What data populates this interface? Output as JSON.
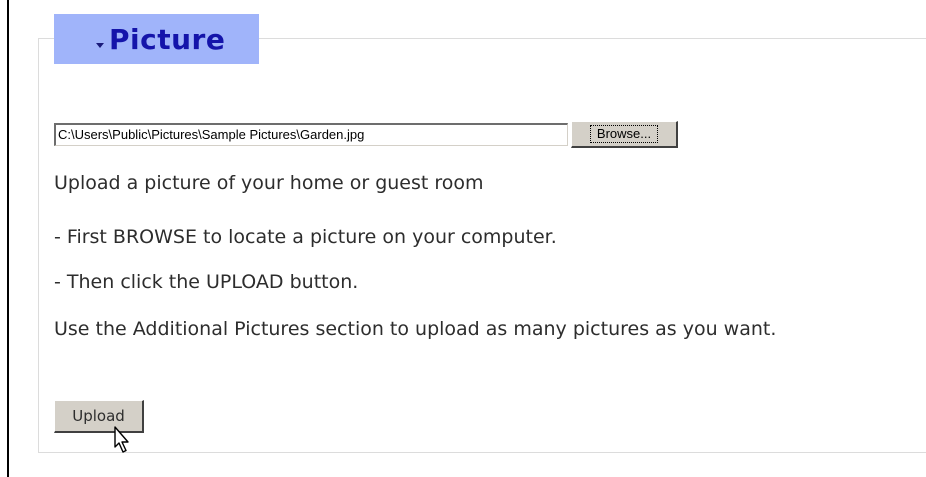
{
  "section": {
    "title": "Picture",
    "caret_icon": "caret-down-icon"
  },
  "file_input": {
    "value": "C:\\Users\\Public\\Pictures\\Sample Pictures\\Garden.jpg"
  },
  "buttons": {
    "browse_label": "Browse...",
    "upload_label": "Upload"
  },
  "instructions": {
    "line1": "Upload a picture of your home or guest room",
    "line2": "- First BROWSE to locate a picture on your computer.",
    "line3": "- Then click the UPLOAD button.",
    "line4": "Use the Additional Pictures section to upload as many pictures as you want."
  },
  "cursor": {
    "icon": "hand-pointer-icon"
  },
  "colors": {
    "legend_background": "#a0b4fa",
    "legend_text": "#1414aa",
    "button_face": "#d4d0c8",
    "body_text": "#2d2d2d"
  }
}
